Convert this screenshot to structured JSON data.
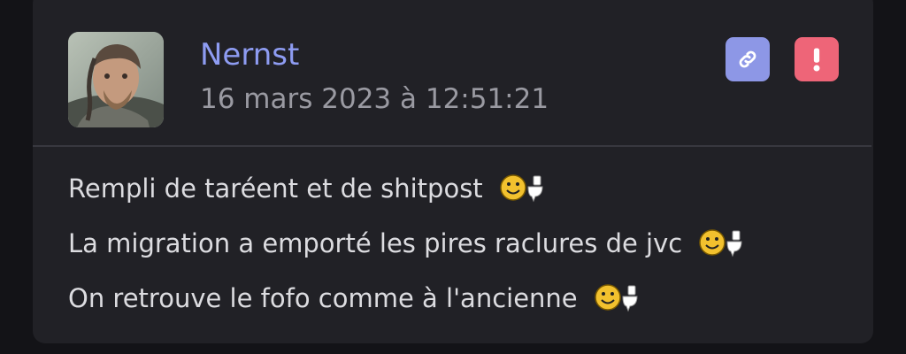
{
  "post": {
    "author": "Nernst",
    "timestamp": "16 mars 2023 à 12:51:21",
    "avatar_icon": "viking-portrait",
    "actions": {
      "permalink_icon": "link-icon",
      "report_icon": "exclamation-icon"
    },
    "lines": [
      "Rempli de taréent et de shitpost",
      "La migration a emporté les pires raclures de jvc",
      "On retrouve le fofo comme à l'ancienne"
    ],
    "emoji": "toilet-smiley"
  },
  "colors": {
    "background": "#131317",
    "card": "#212126",
    "username": "#8e9cf2",
    "link_button": "#8d97e6",
    "report_button": "#ee6578",
    "text": "#dcdce0",
    "muted": "#9a9aa2"
  }
}
